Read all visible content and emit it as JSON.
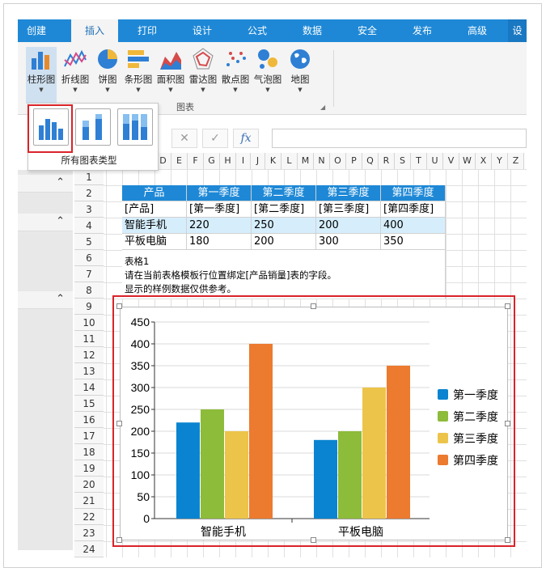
{
  "tabs": [
    "创建",
    "插入",
    "打印",
    "设计",
    "公式",
    "数据",
    "安全",
    "发布",
    "高级",
    "设"
  ],
  "ribbon": {
    "buttons": [
      {
        "label": "柱形图",
        "icon": "bar-chart-icon"
      },
      {
        "label": "折线图",
        "icon": "line-chart-icon"
      },
      {
        "label": "饼图",
        "icon": "pie-chart-icon"
      },
      {
        "label": "条形图",
        "icon": "hbar-chart-icon"
      },
      {
        "label": "面积图",
        "icon": "area-chart-icon"
      },
      {
        "label": "雷达图",
        "icon": "radar-chart-icon"
      },
      {
        "label": "散点图",
        "icon": "scatter-chart-icon"
      },
      {
        "label": "气泡图",
        "icon": "bubble-chart-icon"
      },
      {
        "label": "地图",
        "icon": "map-globe-icon"
      }
    ],
    "group_label": "图表"
  },
  "dropdown": {
    "caption": "所有图表类型"
  },
  "formula": {
    "cancel": "✕",
    "confirm": "✓",
    "fx": "fx"
  },
  "columns": [
    "D",
    "E",
    "F",
    "G",
    "H",
    "I",
    "J",
    "K",
    "L",
    "M",
    "N",
    "O",
    "P",
    "Q",
    "R",
    "S",
    "T",
    "U",
    "V",
    "W",
    "X",
    "Y",
    "Z"
  ],
  "rows": [
    "1",
    "2",
    "3",
    "4",
    "5",
    "6",
    "7",
    "8",
    "9",
    "10",
    "11",
    "12",
    "13",
    "14",
    "15",
    "16",
    "17",
    "18",
    "19",
    "20",
    "21",
    "22",
    "23",
    "24"
  ],
  "table": {
    "header": [
      "产品",
      "第一季度",
      "第二季度",
      "第三季度",
      "第四季度"
    ],
    "template": [
      "[产品]",
      "[第一季度]",
      "[第二季度]",
      "[第三季度]",
      "[第四季度]"
    ],
    "data": [
      [
        "智能手机",
        "220",
        "250",
        "200",
        "400"
      ],
      [
        "平板电脑",
        "180",
        "200",
        "300",
        "350"
      ]
    ]
  },
  "notes": [
    "表格1",
    "请在当前表格模板行位置绑定[产品销量]表的字段。",
    "显示的样例数据仅供参考。"
  ],
  "chart_data": {
    "type": "bar",
    "categories": [
      "智能手机",
      "平板电脑"
    ],
    "series": [
      {
        "name": "第一季度",
        "values": [
          220,
          180
        ],
        "color": "#0a84d0"
      },
      {
        "name": "第二季度",
        "values": [
          250,
          200
        ],
        "color": "#8dbb3a"
      },
      {
        "name": "第三季度",
        "values": [
          200,
          300
        ],
        "color": "#ecc44a"
      },
      {
        "name": "第四季度",
        "values": [
          400,
          350
        ],
        "color": "#ec7a2f"
      }
    ],
    "yticks": [
      "0",
      "50",
      "100",
      "150",
      "200",
      "250",
      "300",
      "350",
      "400",
      "450"
    ],
    "ylim": [
      0,
      450
    ],
    "grid": true,
    "legend": "right"
  },
  "colors": {
    "accent": "#1e88d6",
    "highlight": "#d9232a"
  }
}
